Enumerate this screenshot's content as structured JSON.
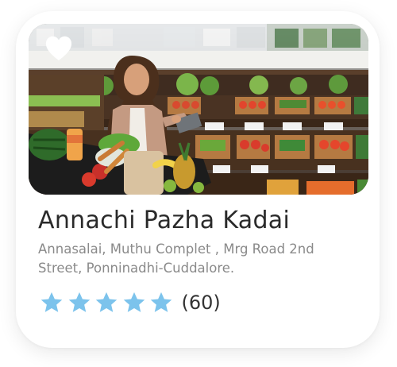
{
  "store": {
    "name": "Annachi Pazha Kadai",
    "address": "Annasalai, Muthu Complet , Mrg Road 2nd Street, Ponninadhi-Cuddalore.",
    "rating": 5,
    "rating_max": 5,
    "review_count": "(60)"
  },
  "icons": {
    "favorite": "heart-icon",
    "rating": "star-icon"
  },
  "colors": {
    "star": "#7cc3ec",
    "heart": "#ffffff",
    "title": "#2a2a2a",
    "address": "#8a8a8a"
  }
}
